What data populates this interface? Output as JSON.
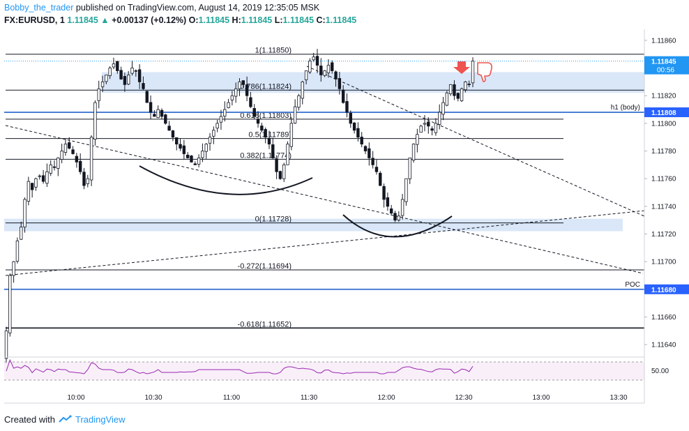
{
  "header": {
    "author": "Bobby_the_trader",
    "published": "published on TradingView.com, August 14, 2019 12:35:05 MSK",
    "symbol": "FX:EURUSD, 1",
    "last": "1.11845",
    "change_arrow": "▲",
    "change": "+0.00137 (+0.12%)",
    "o_label": "O:",
    "o_value": "1.11845",
    "h_label": "H:",
    "h_value": "1.11845",
    "l_label": "L:",
    "l_value": "1.11845",
    "c_label": "C:",
    "c_value": "1.11845"
  },
  "footer": {
    "created_with": "Created with",
    "brand": "TradingView",
    "logo_icon": "tradingview-cloud-icon"
  },
  "colors": {
    "up": "#26a69a",
    "down": "#ef5350",
    "candle": "#131722",
    "blue_line": "#4a7fd4",
    "zone": "#d4e3f7",
    "ma_fast": "#9fc3e8",
    "ma_mid": "#f2cf7e",
    "ma_slow": "#cfcfcf",
    "rsi": "#9c27b0"
  },
  "chart_data": {
    "type": "candlestick",
    "symbol": "EURUSD",
    "ylim": [
      1.11632,
      1.11868
    ],
    "y_ticks": [
      "1.11860",
      "1.11840",
      "1.11820",
      "1.11800",
      "1.11780",
      "1.11760",
      "1.11740",
      "1.11720",
      "1.11700",
      "1.11680",
      "1.11660",
      "1.11640"
    ],
    "x_ticks": [
      "10:00",
      "10:30",
      "11:00",
      "11:30",
      "12:00",
      "12:30",
      "13:00",
      "13:30"
    ],
    "price_labels": [
      {
        "text": "1.11845",
        "value": 1.11845,
        "sub": "00:56",
        "color": "#2196f3"
      },
      {
        "text": "1.11808",
        "value": 1.11808,
        "color": "#2962ff"
      },
      {
        "text": "1.11680",
        "value": 1.1168,
        "color": "#2962ff"
      }
    ],
    "horizontal_lines": [
      {
        "label": "h1 (body)",
        "value": 1.11808
      },
      {
        "label": "POC",
        "value": 1.1168
      }
    ],
    "fib_levels": [
      {
        "ratio": "1",
        "value": 1.1185,
        "text": "1(1.11850)"
      },
      {
        "ratio": "0.786",
        "value": 1.11824,
        "text": "0.786(1.11824)"
      },
      {
        "ratio": "0.618",
        "value": 1.11803,
        "text": "0.618(1.11803)"
      },
      {
        "ratio": "0.5",
        "value": 1.11789,
        "text": "0.5(1.11789)"
      },
      {
        "ratio": "0.382",
        "value": 1.11774,
        "text": "0.382(1.11774)"
      },
      {
        "ratio": "0",
        "value": 1.11728,
        "text": "0(1.11728)"
      },
      {
        "ratio": "-0.272",
        "value": 1.11694,
        "text": "-0.272(1.11694)"
      },
      {
        "ratio": "-0.618",
        "value": 1.11652,
        "text": "-0.618(1.11652)"
      }
    ],
    "zones": [
      {
        "from": 1.11822,
        "to": 1.11837
      },
      {
        "from": 1.11722,
        "to": 1.11731
      }
    ],
    "candles_close": [
      1.1165,
      1.1169,
      1.117,
      1.11715,
      1.11725,
      1.11745,
      1.11758,
      1.11752,
      1.1176,
      1.11762,
      1.11758,
      1.11765,
      1.1177,
      1.11768,
      1.11775,
      1.1178,
      1.11785,
      1.11782,
      1.11778,
      1.11772,
      1.11765,
      1.11755,
      1.1176,
      1.1179,
      1.11815,
      1.11825,
      1.1183,
      1.11835,
      1.1184,
      1.11843,
      1.11838,
      1.11832,
      1.11828,
      1.11835,
      1.1184,
      1.11838,
      1.1183,
      1.11825,
      1.11815,
      1.11808,
      1.11805,
      1.1181,
      1.11805,
      1.118,
      1.11795,
      1.1179,
      1.11785,
      1.11782,
      1.11778,
      1.11775,
      1.11772,
      1.1177,
      1.11775,
      1.1178,
      1.11785,
      1.1179,
      1.11795,
      1.118,
      1.11805,
      1.1181,
      1.11815,
      1.1182,
      1.11825,
      1.1183,
      1.11828,
      1.1182,
      1.11812,
      1.11805,
      1.118,
      1.11795,
      1.1179,
      1.11785,
      1.11775,
      1.11765,
      1.1176,
      1.1177,
      1.11785,
      1.118,
      1.11812,
      1.1182,
      1.1183,
      1.11838,
      1.11845,
      1.11848,
      1.11842,
      1.11835,
      1.11838,
      1.11842,
      1.11838,
      1.11832,
      1.11825,
      1.11815,
      1.11808,
      1.118,
      1.11795,
      1.1179,
      1.11785,
      1.1178,
      1.11775,
      1.1177,
      1.11765,
      1.11755,
      1.11745,
      1.1174,
      1.11735,
      1.1173,
      1.11733,
      1.11745,
      1.1176,
      1.11775,
      1.11785,
      1.11792,
      1.11798,
      1.118,
      1.11798,
      1.11795,
      1.118,
      1.11808,
      1.11815,
      1.11822,
      1.11828,
      1.1182,
      1.11818,
      1.11825,
      1.1183,
      1.11828,
      1.11845
    ],
    "rsi": {
      "level": 50.0,
      "label": "50.00"
    },
    "legend": "none"
  }
}
